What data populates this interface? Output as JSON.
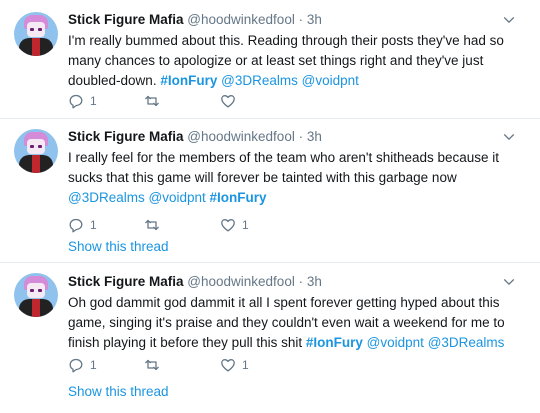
{
  "tweets": [
    {
      "display_name": "Stick Figure Mafia",
      "handle": "@hoodwinkedfool",
      "separator": "·",
      "time": "3h",
      "text_parts": [
        {
          "text": "I'm really bummed about this. Reading through their posts they've had so many chances to apologize or at least set things right and they've just doubled-down. ",
          "type": "plain"
        },
        {
          "text": "#IonFury",
          "type": "hashtag"
        },
        {
          "text": " ",
          "type": "plain"
        },
        {
          "text": "@3DRealms",
          "type": "link"
        },
        {
          "text": " ",
          "type": "plain"
        },
        {
          "text": "@voidpnt",
          "type": "link"
        }
      ],
      "reply_count": "1",
      "retweet_count": "",
      "like_count": "",
      "show_thread": ""
    },
    {
      "display_name": "Stick Figure Mafia",
      "handle": "@hoodwinkedfool",
      "separator": "·",
      "time": "3h",
      "text_parts": [
        {
          "text": "I really feel for the members of the team who aren't shitheads because it sucks that this game will forever be tainted with this garbage now ",
          "type": "plain"
        },
        {
          "text": "@3DRealms",
          "type": "link"
        },
        {
          "text": " ",
          "type": "plain"
        },
        {
          "text": "@voidpnt",
          "type": "link"
        },
        {
          "text": " ",
          "type": "plain"
        },
        {
          "text": "#IonFury",
          "type": "hashtag"
        }
      ],
      "reply_count": "1",
      "retweet_count": "",
      "like_count": "1",
      "show_thread": "Show this thread"
    },
    {
      "display_name": "Stick Figure Mafia",
      "handle": "@hoodwinkedfool",
      "separator": "·",
      "time": "3h",
      "text_parts": [
        {
          "text": "Oh god dammit god dammit it all I spent forever getting hyped about this game, singing it's praise and they couldn't even wait a weekend for me to finish playing it before they pull this shit ",
          "type": "plain"
        },
        {
          "text": "#IonFury",
          "type": "hashtag"
        },
        {
          "text": " ",
          "type": "plain"
        },
        {
          "text": "@voidpnt",
          "type": "link"
        },
        {
          "text": " ",
          "type": "plain"
        },
        {
          "text": "@3DRealms",
          "type": "link"
        }
      ],
      "reply_count": "1",
      "retweet_count": "",
      "like_count": "1",
      "show_thread": "Show this thread"
    }
  ],
  "icons": {
    "reply": "reply-icon",
    "retweet": "retweet-icon",
    "like": "heart-icon",
    "caret": "chevron-down-icon"
  },
  "colors": {
    "link": "#1b95e0",
    "muted": "#657786",
    "text": "#14171a",
    "divider": "#e6ecf0"
  }
}
